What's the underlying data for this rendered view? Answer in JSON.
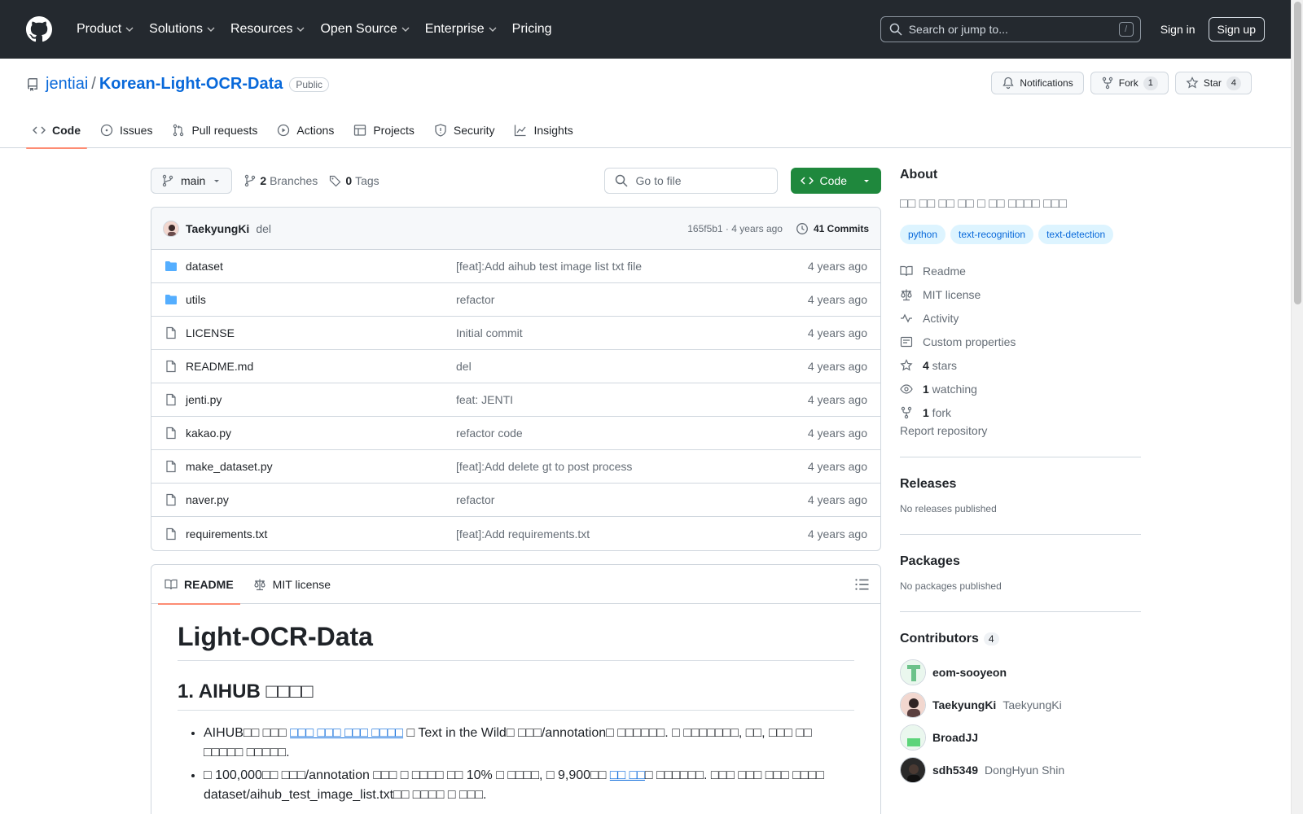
{
  "header": {
    "nav": [
      "Product",
      "Solutions",
      "Resources",
      "Open Source",
      "Enterprise",
      "Pricing"
    ],
    "search_placeholder": "Search or jump to...",
    "search_key": "/",
    "sign_in": "Sign in",
    "sign_up": "Sign up"
  },
  "repo": {
    "owner": "jentiai",
    "separator": "/",
    "name": "Korean-Light-OCR-Data",
    "visibility": "Public",
    "notifications_label": "Notifications",
    "fork_label": "Fork",
    "fork_count": "1",
    "star_label": "Star",
    "star_count": "4"
  },
  "tabs": [
    {
      "label": "Code",
      "icon": "code-icon"
    },
    {
      "label": "Issues",
      "icon": "issue-icon"
    },
    {
      "label": "Pull requests",
      "icon": "pull-request-icon"
    },
    {
      "label": "Actions",
      "icon": "play-icon"
    },
    {
      "label": "Projects",
      "icon": "table-icon"
    },
    {
      "label": "Security",
      "icon": "shield-icon"
    },
    {
      "label": "Insights",
      "icon": "graph-icon"
    }
  ],
  "toolbar": {
    "branch": "main",
    "branches_count": "2",
    "branches_label": "Branches",
    "tags_count": "0",
    "tags_label": "Tags",
    "goto_placeholder": "Go to file",
    "code_button": "Code"
  },
  "commit": {
    "author": "TaekyungKi",
    "message": "del",
    "meta": "165f5b1 · 4 years ago",
    "count_label": "41 Commits"
  },
  "files": [
    {
      "name": "dataset",
      "type": "folder",
      "message": "[feat]:Add aihub test image list txt file",
      "time": "4 years ago"
    },
    {
      "name": "utils",
      "type": "folder",
      "message": "refactor",
      "time": "4 years ago"
    },
    {
      "name": "LICENSE",
      "type": "file",
      "message": "Initial commit",
      "time": "4 years ago"
    },
    {
      "name": "README.md",
      "type": "file",
      "message": "del",
      "time": "4 years ago"
    },
    {
      "name": "jenti.py",
      "type": "file",
      "message": "feat: JENTI",
      "time": "4 years ago"
    },
    {
      "name": "kakao.py",
      "type": "file",
      "message": "refactor code",
      "time": "4 years ago"
    },
    {
      "name": "make_dataset.py",
      "type": "file",
      "message": "[feat]:Add delete gt to post process",
      "time": "4 years ago"
    },
    {
      "name": "naver.py",
      "type": "file",
      "message": "refactor",
      "time": "4 years ago"
    },
    {
      "name": "requirements.txt",
      "type": "file",
      "message": "[feat]:Add requirements.txt",
      "time": "4 years ago"
    }
  ],
  "readme": {
    "tab_readme": "README",
    "tab_license": "MIT license",
    "h1": "Light-OCR-Data",
    "h2": "1. AIHUB □□□□",
    "bullet1_pre": "AIHUB□□ □□□ ",
    "bullet1_link": "□□□ □□□ □□□ □□□□",
    "bullet1_post": " □ Text in the Wild□ □□□/annotation□ □□□□□□. □ □□□□□□□, □□, □□□ □□ □□□□□ □□□□□.",
    "bullet2_pre": "□ 100,000□□ □□□/annotation □□□ □ □□□□ □□ 10% □ □□□□, □ 9,900□□ ",
    "bullet2_link": "□□ □□",
    "bullet2_post": "□ □□□□□□. □□□ □□□ □□□ □□□□ dataset/aihub_test_image_list.txt□□ □□□□ □ □□□."
  },
  "about": {
    "title": "About",
    "description": "□□ □□ □□ □□ □ □□ □□□□ □□□",
    "topics": [
      "python",
      "text-recognition",
      "text-detection"
    ],
    "items": [
      {
        "icon": "book-icon",
        "bold": "",
        "text": "Readme"
      },
      {
        "icon": "law-icon",
        "bold": "",
        "text": "MIT license"
      },
      {
        "icon": "pulse-icon",
        "bold": "",
        "text": "Activity"
      },
      {
        "icon": "note-icon",
        "bold": "",
        "text": "Custom properties"
      },
      {
        "icon": "star-icon",
        "bold": "4",
        "text": " stars"
      },
      {
        "icon": "eye-icon",
        "bold": "1",
        "text": " watching"
      },
      {
        "icon": "fork-icon",
        "bold": "1",
        "text": " fork"
      }
    ],
    "report": "Report repository"
  },
  "releases": {
    "title": "Releases",
    "text": "No releases published"
  },
  "packages": {
    "title": "Packages",
    "text": "No packages published"
  },
  "contributors": {
    "title": "Contributors",
    "count": "4",
    "list": [
      {
        "login": "eom-sooyeon",
        "name": ""
      },
      {
        "login": "TaekyungKi",
        "name": "TaekyungKi"
      },
      {
        "login": "BroadJJ",
        "name": ""
      },
      {
        "login": "sdh5349",
        "name": "DongHyun Shin"
      }
    ]
  }
}
